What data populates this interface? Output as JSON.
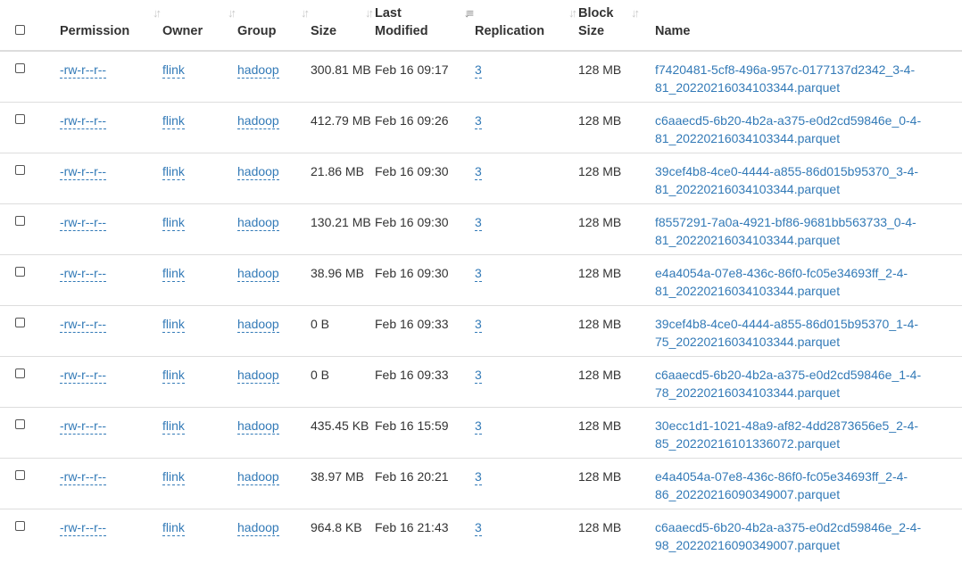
{
  "columns": {
    "permission": "Permission",
    "owner": "Owner",
    "group": "Group",
    "size": "Size",
    "last_modified": "Last Modified",
    "replication": "Replication",
    "block_size": "Block Size",
    "name": "Name"
  },
  "sort": {
    "column": "last_modified",
    "direction": "ascending"
  },
  "rows": [
    {
      "permission": "-rw-r--r--",
      "owner": "flink",
      "group": "hadoop",
      "size": "300.81 MB",
      "modified": "Feb 16 09:17",
      "replication": "3",
      "block_size": "128 MB",
      "name": "f7420481-5cf8-496a-957c-0177137d2342_3-4-81_20220216034103344.parquet"
    },
    {
      "permission": "-rw-r--r--",
      "owner": "flink",
      "group": "hadoop",
      "size": "412.79 MB",
      "modified": "Feb 16 09:26",
      "replication": "3",
      "block_size": "128 MB",
      "name": "c6aaecd5-6b20-4b2a-a375-e0d2cd59846e_0-4-81_20220216034103344.parquet"
    },
    {
      "permission": "-rw-r--r--",
      "owner": "flink",
      "group": "hadoop",
      "size": "21.86 MB",
      "modified": "Feb 16 09:30",
      "replication": "3",
      "block_size": "128 MB",
      "name": "39cef4b8-4ce0-4444-a855-86d015b95370_3-4-81_20220216034103344.parquet"
    },
    {
      "permission": "-rw-r--r--",
      "owner": "flink",
      "group": "hadoop",
      "size": "130.21 MB",
      "modified": "Feb 16 09:30",
      "replication": "3",
      "block_size": "128 MB",
      "name": "f8557291-7a0a-4921-bf86-9681bb563733_0-4-81_20220216034103344.parquet"
    },
    {
      "permission": "-rw-r--r--",
      "owner": "flink",
      "group": "hadoop",
      "size": "38.96 MB",
      "modified": "Feb 16 09:30",
      "replication": "3",
      "block_size": "128 MB",
      "name": "e4a4054a-07e8-436c-86f0-fc05e34693ff_2-4-81_20220216034103344.parquet"
    },
    {
      "permission": "-rw-r--r--",
      "owner": "flink",
      "group": "hadoop",
      "size": "0 B",
      "modified": "Feb 16 09:33",
      "replication": "3",
      "block_size": "128 MB",
      "name": "39cef4b8-4ce0-4444-a855-86d015b95370_1-4-75_20220216034103344.parquet"
    },
    {
      "permission": "-rw-r--r--",
      "owner": "flink",
      "group": "hadoop",
      "size": "0 B",
      "modified": "Feb 16 09:33",
      "replication": "3",
      "block_size": "128 MB",
      "name": "c6aaecd5-6b20-4b2a-a375-e0d2cd59846e_1-4-78_20220216034103344.parquet"
    },
    {
      "permission": "-rw-r--r--",
      "owner": "flink",
      "group": "hadoop",
      "size": "435.45 KB",
      "modified": "Feb 16 15:59",
      "replication": "3",
      "block_size": "128 MB",
      "name": "30ecc1d1-1021-48a9-af82-4dd2873656e5_2-4-85_20220216101336072.parquet"
    },
    {
      "permission": "-rw-r--r--",
      "owner": "flink",
      "group": "hadoop",
      "size": "38.97 MB",
      "modified": "Feb 16 20:21",
      "replication": "3",
      "block_size": "128 MB",
      "name": "e4a4054a-07e8-436c-86f0-fc05e34693ff_2-4-86_20220216090349007.parquet"
    },
    {
      "permission": "-rw-r--r--",
      "owner": "flink",
      "group": "hadoop",
      "size": "964.8 KB",
      "modified": "Feb 16 21:43",
      "replication": "3",
      "block_size": "128 MB",
      "name": "c6aaecd5-6b20-4b2a-a375-e0d2cd59846e_2-4-98_20220216090349007.parquet"
    }
  ]
}
